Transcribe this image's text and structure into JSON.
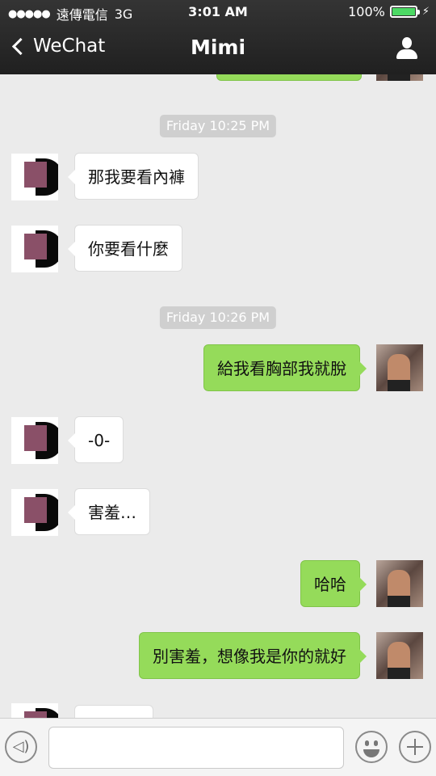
{
  "status_bar": {
    "signal_dots": "●●●●●",
    "carrier": "遠傳電信",
    "network": "3G",
    "time": "3:01 AM",
    "battery": "100%",
    "battery_level": 1.0
  },
  "nav": {
    "back_label": "WeChat",
    "title": "Mimi",
    "profile_icon": "person-icon"
  },
  "chat": {
    "timestamps": [
      "Friday 10:25 PM",
      "Friday 10:26 PM"
    ],
    "messages": [
      {
        "side": "in",
        "text": "那我要看內褲"
      },
      {
        "side": "in",
        "text": "你要看什麼"
      },
      {
        "side": "out",
        "text": "給我看胸部我就脫"
      },
      {
        "side": "in",
        "text": "-0-"
      },
      {
        "side": "in",
        "text": "害羞…"
      },
      {
        "side": "out",
        "text": "哈哈"
      },
      {
        "side": "out",
        "text": "別害羞，想像我是你的就好"
      },
      {
        "side": "in",
        "text": ""
      }
    ]
  },
  "input_bar": {
    "voice_icon": "voice-icon",
    "voice_glyph": "◁)",
    "text_value": "",
    "emoji_icon": "emoji-icon",
    "plus_icon": "plus-icon"
  },
  "colors": {
    "outgoing_bubble": "#95db5a",
    "incoming_bubble": "#ffffff",
    "nav_bar": "#2a2a2a",
    "chat_background": "#ebebeb"
  }
}
